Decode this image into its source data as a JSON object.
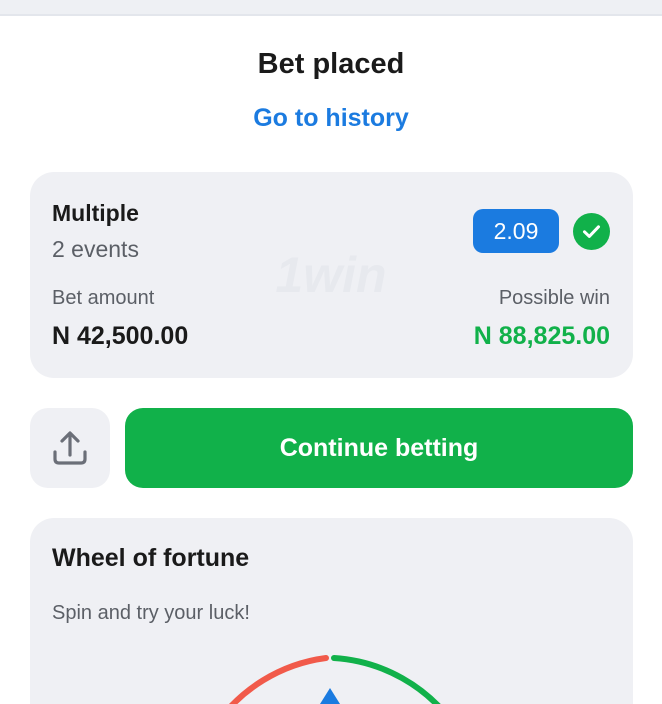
{
  "header": {
    "title": "Bet placed",
    "history_link": "Go to history"
  },
  "bet": {
    "type": "Multiple",
    "events": "2 events",
    "odds": "2.09",
    "status_icon": "check-icon",
    "amount_label": "Bet amount",
    "amount_value": "N 42,500.00",
    "win_label": "Possible win",
    "win_value": "N 88,825.00",
    "watermark": "1win"
  },
  "actions": {
    "share_icon": "share-icon",
    "continue_label": "Continue betting"
  },
  "wheel": {
    "title": "Wheel of fortune",
    "subtitle": "Spin and try your luck!"
  },
  "colors": {
    "accent_blue": "#1b7be0",
    "accent_green": "#11b14a",
    "card_bg": "#eff0f4",
    "wheel_red": "#f15a4a"
  }
}
